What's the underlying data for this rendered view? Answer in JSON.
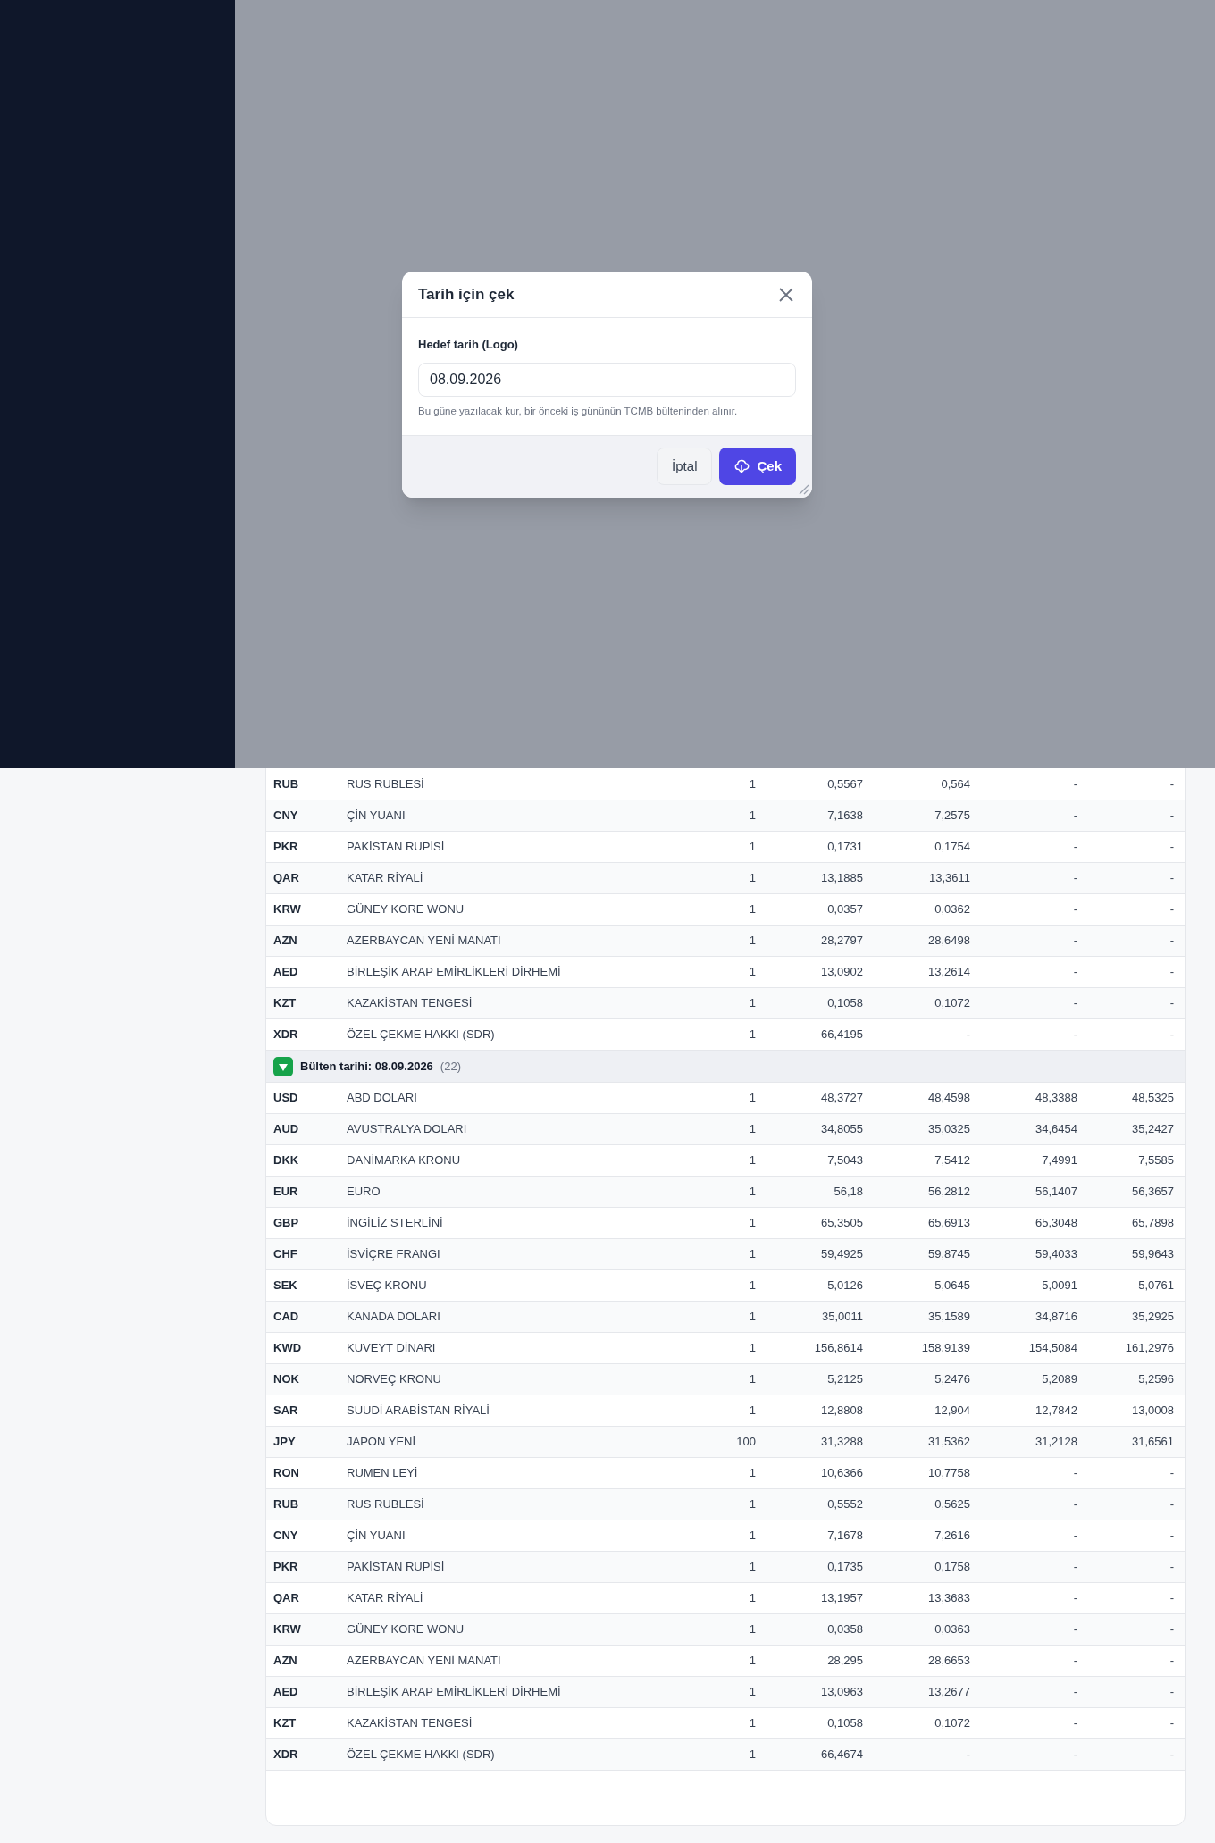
{
  "dialog": {
    "title": "Tarih için çek",
    "field": {
      "label": "Hedef tarih (Logo)",
      "value": "08.09.2026",
      "hint": "Bu güne yazılacak kur, bir önceki iş gününün TCMB bülteninden alınır."
    },
    "buttons": [
      {
        "kind": "secondary",
        "label": "İptal"
      },
      {
        "kind": "primary",
        "label": "Çek"
      }
    ]
  },
  "table": {
    "sections": [
      {
        "rows": [
          [
            "RUB",
            "RUS RUBLESİ",
            "1",
            "0,5567",
            "0,564",
            "-",
            "-"
          ],
          [
            "CNY",
            "ÇİN YUANI",
            "1",
            "7,1638",
            "7,2575",
            "-",
            "-"
          ],
          [
            "PKR",
            "PAKİSTAN RUPİSİ",
            "1",
            "0,1731",
            "0,1754",
            "-",
            "-"
          ],
          [
            "QAR",
            "KATAR RİYALİ",
            "1",
            "13,1885",
            "13,3611",
            "-",
            "-"
          ],
          [
            "KRW",
            "GÜNEY KORE WONU",
            "1",
            "0,0357",
            "0,0362",
            "-",
            "-"
          ],
          [
            "AZN",
            "AZERBAYCAN YENİ MANATI",
            "1",
            "28,2797",
            "28,6498",
            "-",
            "-"
          ],
          [
            "AED",
            "BİRLEŞİK ARAP EMİRLİKLERİ DİRHEMİ",
            "1",
            "13,0902",
            "13,2614",
            "-",
            "-"
          ],
          [
            "KZT",
            "KAZAKİSTAN TENGESİ",
            "1",
            "0,1058",
            "0,1072",
            "-",
            "-"
          ],
          [
            "XDR",
            "ÖZEL ÇEKME HAKKI (SDR)",
            "1",
            "66,4195",
            "-",
            "-",
            "-"
          ]
        ]
      },
      {
        "header": {
          "label": "Bülten tarihi: 08.09.2026",
          "count": "(22)",
          "expanded": true
        },
        "rows": [
          [
            "USD",
            "ABD DOLARI",
            "1",
            "48,3727",
            "48,4598",
            "48,3388",
            "48,5325"
          ],
          [
            "AUD",
            "AVUSTRALYA DOLARI",
            "1",
            "34,8055",
            "35,0325",
            "34,6454",
            "35,2427"
          ],
          [
            "DKK",
            "DANİMARKA KRONU",
            "1",
            "7,5043",
            "7,5412",
            "7,4991",
            "7,5585"
          ],
          [
            "EUR",
            "EURO",
            "1",
            "56,18",
            "56,2812",
            "56,1407",
            "56,3657"
          ],
          [
            "GBP",
            "İNGİLİZ STERLİNİ",
            "1",
            "65,3505",
            "65,6913",
            "65,3048",
            "65,7898"
          ],
          [
            "CHF",
            "İSVİÇRE FRANGI",
            "1",
            "59,4925",
            "59,8745",
            "59,4033",
            "59,9643"
          ],
          [
            "SEK",
            "İSVEÇ KRONU",
            "1",
            "5,0126",
            "5,0645",
            "5,0091",
            "5,0761"
          ],
          [
            "CAD",
            "KANADA DOLARI",
            "1",
            "35,0011",
            "35,1589",
            "34,8716",
            "35,2925"
          ],
          [
            "KWD",
            "KUVEYT DİNARI",
            "1",
            "156,8614",
            "158,9139",
            "154,5084",
            "161,2976"
          ],
          [
            "NOK",
            "NORVEÇ KRONU",
            "1",
            "5,2125",
            "5,2476",
            "5,2089",
            "5,2596"
          ],
          [
            "SAR",
            "SUUDİ ARABİSTAN RİYALİ",
            "1",
            "12,8808",
            "12,904",
            "12,7842",
            "13,0008"
          ],
          [
            "JPY",
            "JAPON YENİ",
            "100",
            "31,3288",
            "31,5362",
            "31,2128",
            "31,6561"
          ],
          [
            "RON",
            "RUMEN LEYİ",
            "1",
            "10,6366",
            "10,7758",
            "-",
            "-"
          ],
          [
            "RUB",
            "RUS RUBLESİ",
            "1",
            "0,5552",
            "0,5625",
            "-",
            "-"
          ],
          [
            "CNY",
            "ÇİN YUANI",
            "1",
            "7,1678",
            "7,2616",
            "-",
            "-"
          ],
          [
            "PKR",
            "PAKİSTAN RUPİSİ",
            "1",
            "0,1735",
            "0,1758",
            "-",
            "-"
          ],
          [
            "QAR",
            "KATAR RİYALİ",
            "1",
            "13,1957",
            "13,3683",
            "-",
            "-"
          ],
          [
            "KRW",
            "GÜNEY KORE WONU",
            "1",
            "0,0358",
            "0,0363",
            "-",
            "-"
          ],
          [
            "AZN",
            "AZERBAYCAN YENİ MANATI",
            "1",
            "28,295",
            "28,6653",
            "-",
            "-"
          ],
          [
            "AED",
            "BİRLEŞİK ARAP EMİRLİKLERİ DİRHEMİ",
            "1",
            "13,0963",
            "13,2677",
            "-",
            "-"
          ],
          [
            "KZT",
            "KAZAKİSTAN TENGESİ",
            "1",
            "0,1058",
            "0,1072",
            "-",
            "-"
          ],
          [
            "XDR",
            "ÖZEL ÇEKME HAKKI (SDR)",
            "1",
            "66,4674",
            "-",
            "-",
            "-"
          ]
        ]
      }
    ]
  }
}
